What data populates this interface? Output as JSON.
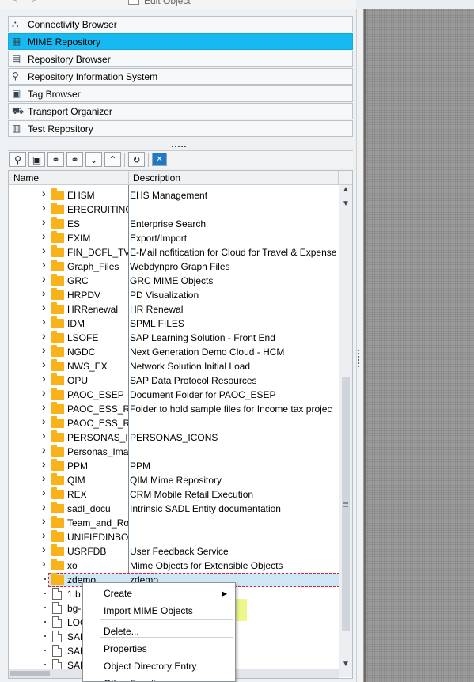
{
  "window": {
    "title": "Edit Object"
  },
  "nav": {
    "items": [
      {
        "label": "Connectivity Browser",
        "selected": false,
        "icon": "connectivity-icon"
      },
      {
        "label": "MIME Repository",
        "selected": true,
        "icon": "mime-repository-icon"
      },
      {
        "label": "Repository Browser",
        "selected": false,
        "icon": "repository-browser-icon"
      },
      {
        "label": "Repository Information System",
        "selected": false,
        "icon": "repository-info-icon"
      },
      {
        "label": "Tag Browser",
        "selected": false,
        "icon": "tag-icon"
      },
      {
        "label": "Transport Organizer",
        "selected": false,
        "icon": "transport-icon"
      },
      {
        "label": "Test Repository",
        "selected": false,
        "icon": "test-repository-icon"
      }
    ]
  },
  "toolbar": {
    "buttons": [
      {
        "icon": "find-icon"
      },
      {
        "icon": "display-object-icon"
      },
      {
        "icon": "binoculars-icon"
      },
      {
        "icon": "binoculars-next-icon"
      },
      {
        "icon": "expand-all-icon"
      },
      {
        "icon": "collapse-all-icon"
      },
      {
        "icon": "refresh-icon"
      },
      {
        "icon": "close-icon"
      }
    ]
  },
  "tree": {
    "columns": {
      "name": "Name",
      "description": "Description"
    },
    "rows": [
      {
        "name": "EHSM",
        "description": "EHS Management",
        "type": "folder"
      },
      {
        "name": "ERECRUITING",
        "description": "",
        "type": "folder"
      },
      {
        "name": "ES",
        "description": "Enterprise Search",
        "type": "folder"
      },
      {
        "name": "EXIM",
        "description": "Export/Import",
        "type": "folder"
      },
      {
        "name": "FIN_DCFL_TV",
        "description": "E-Mail nofitication for Cloud for Travel & Expense",
        "type": "folder"
      },
      {
        "name": "Graph_Files",
        "description": "Webdynpro Graph Files",
        "type": "folder"
      },
      {
        "name": "GRC",
        "description": "GRC MIME Objects",
        "type": "folder"
      },
      {
        "name": "HRPDV",
        "description": "PD Visualization",
        "type": "folder"
      },
      {
        "name": "HRRenewal",
        "description": "HR Renewal",
        "type": "folder"
      },
      {
        "name": "IDM",
        "description": "SPML FILES",
        "type": "folder"
      },
      {
        "name": "LSOFE",
        "description": "SAP Learning Solution - Front End",
        "type": "folder"
      },
      {
        "name": "NGDC",
        "description": "Next Generation Demo Cloud - HCM",
        "type": "folder"
      },
      {
        "name": "NWS_EX",
        "description": "Network Solution Initial Load",
        "type": "folder"
      },
      {
        "name": "OPU",
        "description": "SAP Data Protocol Resources",
        "type": "folder"
      },
      {
        "name": "PAOC_ESEP",
        "description": "Document Folder for PAOC_ESEP",
        "type": "folder"
      },
      {
        "name": "PAOC_ESS_RE",
        "description": "Folder to hold sample files for Income tax projec",
        "type": "folder"
      },
      {
        "name": "PAOC_ESS_RE",
        "description": "",
        "type": "folder"
      },
      {
        "name": "PERSONAS_IC",
        "description": "PERSONAS_ICONS",
        "type": "folder"
      },
      {
        "name": "Personas_Ima",
        "description": "",
        "type": "folder"
      },
      {
        "name": "PPM",
        "description": "PPM",
        "type": "folder"
      },
      {
        "name": "QIM",
        "description": "QIM Mime Repository",
        "type": "folder"
      },
      {
        "name": "REX",
        "description": "CRM Mobile Retail Execution",
        "type": "folder"
      },
      {
        "name": "sadl_docu",
        "description": "Intrinsic SADL Entity documentation",
        "type": "folder"
      },
      {
        "name": "Team_and_Ro",
        "description": "",
        "type": "folder"
      },
      {
        "name": "UNIFIEDINBOX",
        "description": "",
        "type": "folder"
      },
      {
        "name": "USRFDB",
        "description": "User Feedback Service",
        "type": "folder"
      },
      {
        "name": "xo",
        "description": "Mime Objects for Extensible Objects",
        "type": "folder"
      },
      {
        "name": "zdemo",
        "description": "zdemo",
        "type": "folder-open",
        "selected": true
      },
      {
        "name": "1.b",
        "description": "",
        "type": "file"
      },
      {
        "name": "bg-",
        "description": "",
        "type": "file"
      },
      {
        "name": "LOC",
        "description": "",
        "type": "file"
      },
      {
        "name": "SAP",
        "description": "",
        "type": "file"
      },
      {
        "name": "SAP",
        "description": "",
        "type": "file"
      },
      {
        "name": "SAP",
        "description": "",
        "type": "file"
      }
    ]
  },
  "context_menu": {
    "items": [
      {
        "label": "Create",
        "submenu": true
      },
      {
        "label": "Import MIME Objects",
        "highlighted": true
      },
      {
        "label": "Delete...",
        "separator_before": true
      },
      {
        "label": "Properties",
        "separator_before": true
      },
      {
        "label": "Object Directory Entry"
      },
      {
        "label": "Other Functions",
        "submenu": true
      }
    ]
  },
  "colors": {
    "selected_nav": "#16b9f0",
    "highlight": "#edf78a",
    "folder": "#f7b319"
  }
}
